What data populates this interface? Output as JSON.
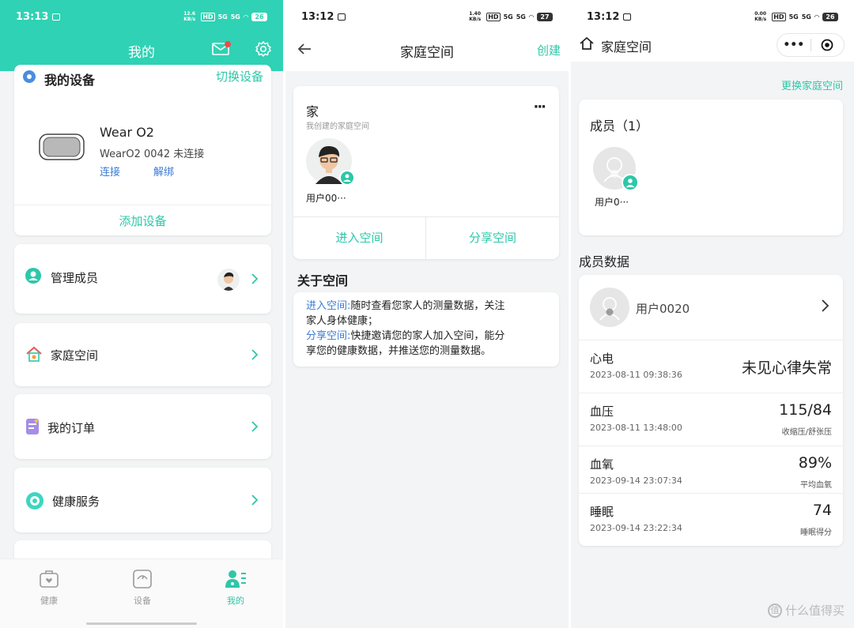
{
  "status_bars": {
    "p1": {
      "time": "13:13",
      "speed": "12.6 KB/s",
      "hd": "HD",
      "sig1": "5G",
      "sig2": "5G",
      "battery": "26"
    },
    "p2": {
      "time": "13:12",
      "speed": "1.40 KB/s",
      "hd": "HD",
      "sig1": "5G",
      "sig2": "5G",
      "battery": "27"
    },
    "p3": {
      "time": "13:12",
      "speed": "0.00 KB/s",
      "hd": "HD",
      "sig1": "5G",
      "sig2": "5G",
      "battery": "26"
    }
  },
  "panel1": {
    "title": "我的",
    "my_devices": {
      "heading": "我的设备",
      "switch_label": "切换设备",
      "device_name": "Wear O2",
      "device_status": "WearO2 0042 未连接",
      "connect_label": "连接",
      "unbind_label": "解绑",
      "add_device_label": "添加设备"
    },
    "rows": [
      {
        "label": "管理成员",
        "icon": "person-circle-icon"
      },
      {
        "label": "家庭空间",
        "icon": "house-icon"
      },
      {
        "label": "我的订单",
        "icon": "order-icon"
      },
      {
        "label": "健康服务",
        "icon": "health-service-icon"
      }
    ],
    "nav": [
      {
        "label": "健康",
        "icon": "health-bag-icon",
        "active": false
      },
      {
        "label": "设备",
        "icon": "scale-icon",
        "active": false
      },
      {
        "label": "我的",
        "icon": "profile-icon",
        "active": true
      }
    ]
  },
  "panel2": {
    "title": "家庭空间",
    "create_label": "创建",
    "space": {
      "name": "家",
      "subtitle": "我创建的家庭空间",
      "more": "···",
      "member_name": "用户00···",
      "enter_label": "进入空间",
      "share_label": "分享空间"
    },
    "about": {
      "heading": "关于空间",
      "enter_key": "进入空间:",
      "enter_text_1": "随时查看您家人的测量数据，关注",
      "enter_text_2": "家人身体健康；",
      "share_key": "分享空间:",
      "share_text_1": "快捷邀请您的家人加入空间，能分",
      "share_text_2": "享您的健康数据，并推送您的测量数据。"
    }
  },
  "panel3": {
    "title": "家庭空间",
    "switch_label": "更换家庭空间",
    "members_heading": "成员（1）",
    "member_name": "用户0···",
    "member_data_heading": "成员数据",
    "user_name": "用户0020",
    "metrics": [
      {
        "name": "心电",
        "time": "2023-08-11 09:38:36",
        "value": "未见心律失常",
        "sub": ""
      },
      {
        "name": "血压",
        "time": "2023-08-11 13:48:00",
        "value": "115/84",
        "sub": "收缩压/舒张压"
      },
      {
        "name": "血氧",
        "time": "2023-09-14 23:07:34",
        "value": "89%",
        "sub": "平均血氧"
      },
      {
        "name": "睡眠",
        "time": "2023-09-14 23:22:34",
        "value": "74",
        "sub": "睡眠得分"
      }
    ]
  },
  "watermark": "什么值得买",
  "colors": {
    "accent": "#2dc7a8",
    "header": "#2fd2b4",
    "link_blue": "#3a7bd5",
    "notification": "#f04a4a"
  }
}
